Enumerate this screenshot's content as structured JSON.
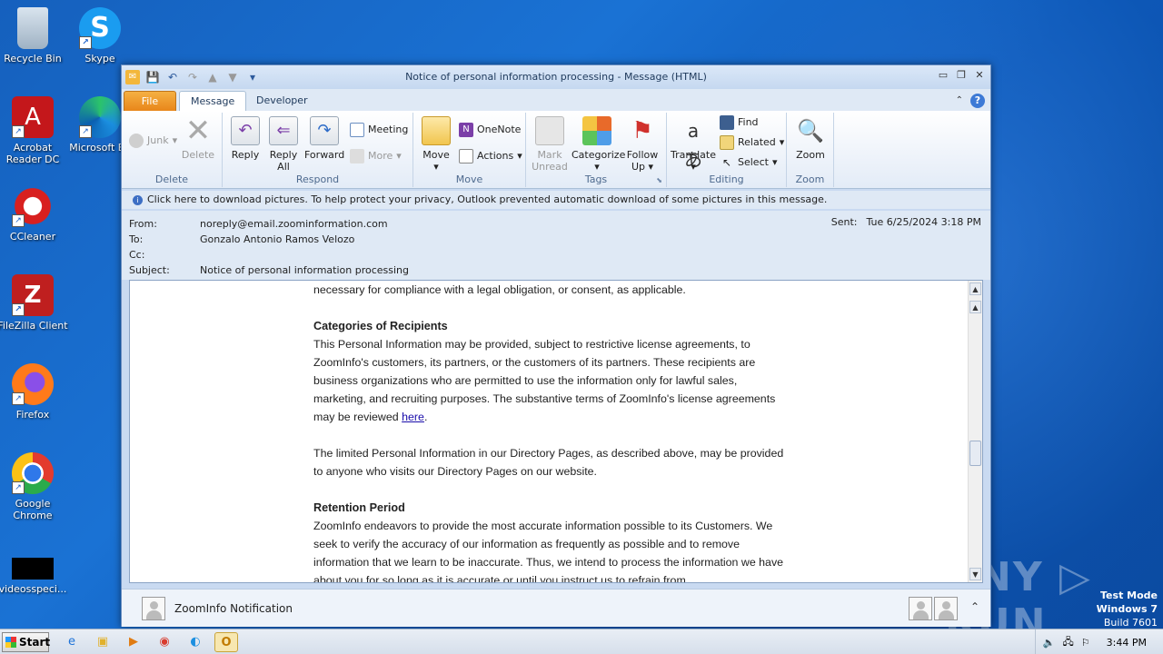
{
  "desktop": {
    "icons": [
      {
        "label": "Recycle Bin"
      },
      {
        "label": "Skype"
      },
      {
        "label": "Acrobat Reader DC"
      },
      {
        "label": "Microsoft Ed"
      },
      {
        "label": "CCleaner"
      },
      {
        "label": "FileZilla Client"
      },
      {
        "label": "Firefox"
      },
      {
        "label": "Google Chrome"
      },
      {
        "label": "videosspeci..."
      }
    ],
    "watermark": "ANY ▷ RUN",
    "test_mode": {
      "line1": "Test Mode",
      "line2": "Windows 7",
      "line3": "Build 7601"
    }
  },
  "window": {
    "title": "Notice of personal information processing  -  Message (HTML)",
    "tabs": {
      "file": "File",
      "message": "Message",
      "developer": "Developer"
    },
    "ribbon": {
      "delete_group": {
        "label": "Delete",
        "junk": "Junk",
        "delete": "Delete"
      },
      "respond_group": {
        "label": "Respond",
        "reply": "Reply",
        "reply_all_1": "Reply",
        "reply_all_2": "All",
        "forward": "Forward",
        "meeting": "Meeting",
        "more": "More"
      },
      "move_group": {
        "label": "Move",
        "move": "Move",
        "onenote": "OneNote",
        "actions": "Actions"
      },
      "tags_group": {
        "label": "Tags",
        "mark_unread_1": "Mark",
        "mark_unread_2": "Unread",
        "categorize": "Categorize",
        "follow_up_1": "Follow",
        "follow_up_2": "Up"
      },
      "editing_group": {
        "label": "Editing",
        "translate": "Translate",
        "find": "Find",
        "related": "Related",
        "select": "Select"
      },
      "zoom_group": {
        "label": "Zoom",
        "zoom": "Zoom"
      }
    },
    "infobar": "Click here to download pictures. To help protect your privacy, Outlook prevented automatic download of some pictures in this message.",
    "header": {
      "from_label": "From:",
      "from": "noreply@email.zoominformation.com",
      "to_label": "To:",
      "to": "Gonzalo Antonio Ramos Velozo",
      "cc_label": "Cc:",
      "cc": "",
      "subject_label": "Subject:",
      "subject": "Notice of personal information processing",
      "sent_label": "Sent:",
      "sent": "Tue 6/25/2024 3:18 PM"
    },
    "body": {
      "line0": "necessary for compliance with a legal obligation, or consent, as applicable.",
      "h_recipients": "Categories of Recipients",
      "p_recipients": "This Personal Information may be provided, subject to restrictive license agreements, to ZoomInfo's customers, its partners, or the customers of its partners. These recipients are business organizations who are permitted to use the information only for lawful sales, marketing, and recruiting purposes. The substantive terms of ZoomInfo's license agreements may be reviewed",
      "link_here": "here",
      "p_directory": "The limited Personal Information in our Directory Pages, as described above, may be provided to anyone who visits our Directory Pages on our website.",
      "h_retention": "Retention Period",
      "p_retention": "ZoomInfo endeavors to provide the most accurate information possible to its Customers. We seek to verify the accuracy of our information as frequently as possible and to remove information that we learn to be inaccurate. Thus, we intend to process the information we have about you for so long as it is accurate or until you instruct us to refrain from"
    },
    "people_pane": {
      "name": "ZoomInfo Notification"
    }
  },
  "taskbar": {
    "start": "Start",
    "clock": "3:44 PM"
  }
}
